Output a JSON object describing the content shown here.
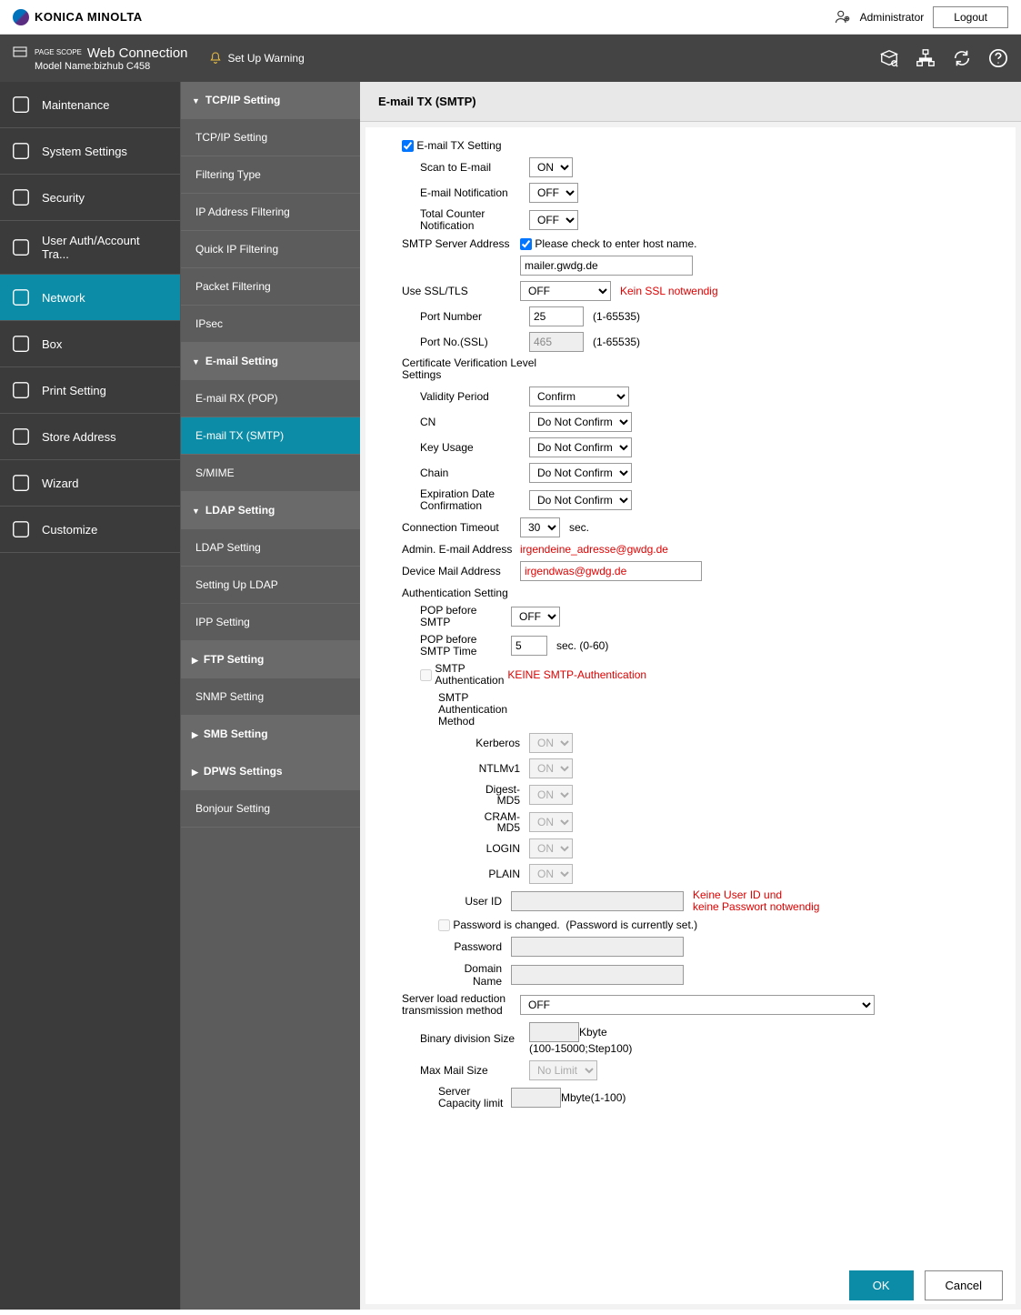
{
  "brand": "KONICA MINOLTA",
  "topbar": {
    "user_role": "Administrator",
    "logout": "Logout"
  },
  "header2": {
    "pagescope_small": "PAGE SCOPE",
    "pagescope": "Web Connection",
    "model_label": "Model Name:bizhub C458",
    "warning": "Set Up Warning"
  },
  "sidebar1": [
    "Maintenance",
    "System Settings",
    "Security",
    "User Auth/Account Tra...",
    "Network",
    "Box",
    "Print Setting",
    "Store Address",
    "Wizard",
    "Customize"
  ],
  "sidebar2": {
    "group_tcp": "TCP/IP Setting",
    "tcp_items": [
      "TCP/IP Setting",
      "Filtering Type",
      "IP Address Filtering",
      "Quick IP Filtering",
      "Packet Filtering",
      "IPsec"
    ],
    "group_email": "E-mail Setting",
    "email_items": [
      "E-mail RX (POP)",
      "E-mail TX (SMTP)",
      "S/MIME"
    ],
    "group_ldap": "LDAP Setting",
    "ldap_items": [
      "LDAP Setting",
      "Setting Up LDAP"
    ],
    "rest": [
      {
        "t": "item",
        "label": "IPP Setting"
      },
      {
        "t": "group_r",
        "label": "FTP Setting"
      },
      {
        "t": "item",
        "label": "SNMP Setting"
      },
      {
        "t": "group_r",
        "label": "SMB Setting"
      },
      {
        "t": "group_r",
        "label": "DPWS Settings"
      },
      {
        "t": "item",
        "label": "Bonjour Setting"
      }
    ]
  },
  "panel": {
    "title": "E-mail TX (SMTP)",
    "cb_main": "E-mail TX Setting",
    "scan_to_email": "Scan to E-mail",
    "scan_to_email_v": "ON",
    "enotif": "E-mail Notification",
    "enotif_v": "OFF",
    "total_counter": "Total Counter Notification",
    "total_counter_v": "OFF",
    "smtp_addr": "SMTP Server Address",
    "smtp_hint": "Please check to enter host name.",
    "smtp_host": "mailer.gwdg.de",
    "use_ssl": "Use SSL/TLS",
    "use_ssl_v": "OFF",
    "ssl_note": "Kein SSL notwendig",
    "port": "Port Number",
    "port_v": "25",
    "port_range": "(1-65535)",
    "port_ssl": "Port No.(SSL)",
    "port_ssl_v": "465",
    "cert_h": "Certificate Verification Level Settings",
    "validity": "Validity Period",
    "validity_v": "Confirm",
    "cn": "CN",
    "cn_v": "Do Not Confirm",
    "keyu": "Key Usage",
    "keyu_v": "Do Not Confirm",
    "chain": "Chain",
    "chain_v": "Do Not Confirm",
    "expd": "Expiration Date Confirmation",
    "expd_v": "Do Not Confirm",
    "conn_to": "Connection Timeout",
    "conn_to_v": "30",
    "conn_to_unit": "sec.",
    "admin_mail": "Admin. E-mail Address",
    "admin_mail_v": "irgendeine_adresse@gwdg.de",
    "device_mail": "Device Mail Address",
    "device_mail_v": "irgendwas@gwdg.de",
    "auth_h": "Authentication Setting",
    "pop_before": "POP before SMTP",
    "pop_before_v": "OFF",
    "pop_time": "POP before SMTP Time",
    "pop_time_v": "5",
    "pop_time_hint": "sec. (0-60)",
    "smtp_auth": "SMTP Authentication",
    "smtp_auth_note": "KEINE SMTP-Authentication",
    "method_h": "SMTP Authentication Method",
    "kerberos": "Kerberos",
    "kerberos_v": "ON",
    "ntlm": "NTLMv1",
    "ntlm_v": "ON",
    "digest": "Digest-MD5",
    "digest_v": "ON",
    "cram": "CRAM-MD5",
    "cram_v": "ON",
    "login": "LOGIN",
    "login_v": "ON",
    "plain": "PLAIN",
    "plain_v": "ON",
    "userid": "User ID",
    "userid_note1": "Keine User ID und",
    "userid_note2": "keine Passwort notwendig",
    "pwd_changed": "Password is changed.",
    "pwd_currently": "(Password is currently set.)",
    "password": "Password",
    "domain": "Domain Name",
    "server_load": "Server load reduction transmission method",
    "server_load_v": "OFF",
    "binary": "Binary division Size",
    "binary_unit": "Kbyte",
    "binary_hint": "(100-15000;Step100)",
    "max_mail": "Max Mail Size",
    "max_mail_v": "No Limit",
    "server_cap": "Server Capacity limit",
    "server_cap_unit": "Mbyte(1-100)",
    "ok": "OK",
    "cancel": "Cancel"
  }
}
